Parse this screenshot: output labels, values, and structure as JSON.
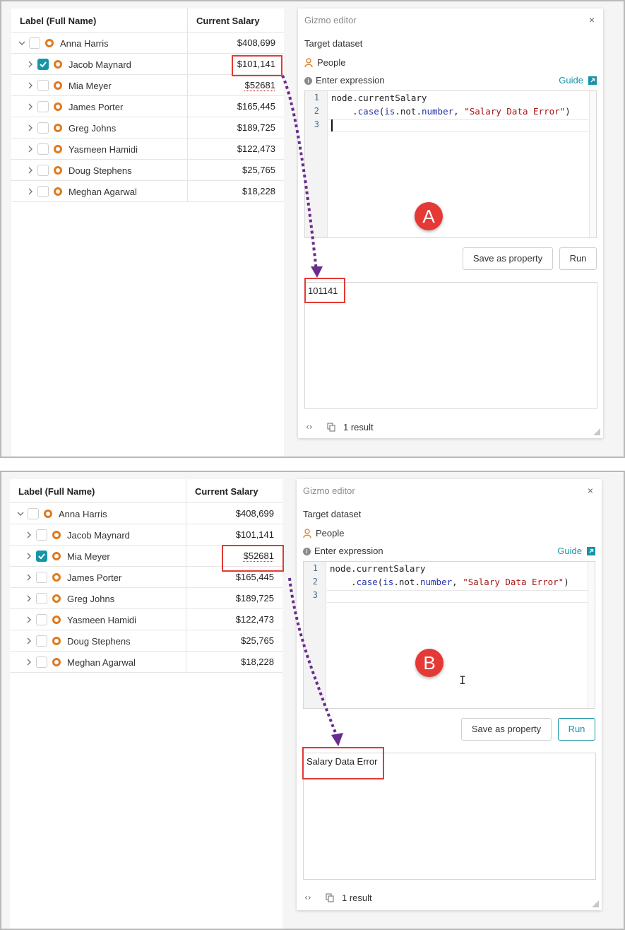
{
  "table": {
    "col_label": "Label (Full Name)",
    "col_salary": "Current Salary",
    "rows": [
      {
        "name": "Anna Harris",
        "salary": "$408,699"
      },
      {
        "name": "Jacob Maynard",
        "salary": "$101,141"
      },
      {
        "name": "Mia Meyer",
        "salary": "$52681"
      },
      {
        "name": "James Porter",
        "salary": "$165,445"
      },
      {
        "name": "Greg Johns",
        "salary": "$189,725"
      },
      {
        "name": "Yasmeen Hamidi",
        "salary": "$122,473"
      },
      {
        "name": "Doug Stephens",
        "salary": "$25,765"
      },
      {
        "name": "Meghan Agarwal",
        "salary": "$18,228"
      }
    ]
  },
  "editor": {
    "title": "Gizmo editor",
    "close": "×",
    "target_label": "Target dataset",
    "dataset": "People",
    "expr_label": "Enter expression",
    "guide": "Guide",
    "line_numbers": [
      "1",
      "2",
      "3"
    ],
    "code_line1": "node.currentSalary",
    "code_l2_indent": "    .",
    "code_l2_fn": "case",
    "code_l2_open": "(",
    "code_l2_is": "is",
    "code_l2_dot1": ".",
    "code_l2_not": "not",
    "code_l2_dot2": ".",
    "code_l2_number": "number",
    "code_l2_comma": ", ",
    "code_l2_str": "\"Salary Data Error\"",
    "code_l2_close": ")",
    "save_button": "Save as property",
    "run_button": "Run",
    "footer_code_icon": "‹›",
    "result_count": "1 result"
  },
  "panel_a": {
    "checked_row": "Jacob Maynard",
    "result": "101141",
    "badge": "A"
  },
  "panel_b": {
    "checked_row": "Mia Meyer",
    "result": "Salary Data Error",
    "badge": "B"
  },
  "colors": {
    "accent": "#1795a8",
    "node": "#e07a1f",
    "highlight": "#e53935",
    "arrow": "#6a2c8f"
  },
  "icons": [
    "chevron-right-icon",
    "chevron-down-icon",
    "checkbox-icon",
    "node-icon",
    "person-icon",
    "info-icon",
    "external-link-icon",
    "code-icon",
    "copy-icon",
    "resize-icon",
    "close-icon"
  ]
}
